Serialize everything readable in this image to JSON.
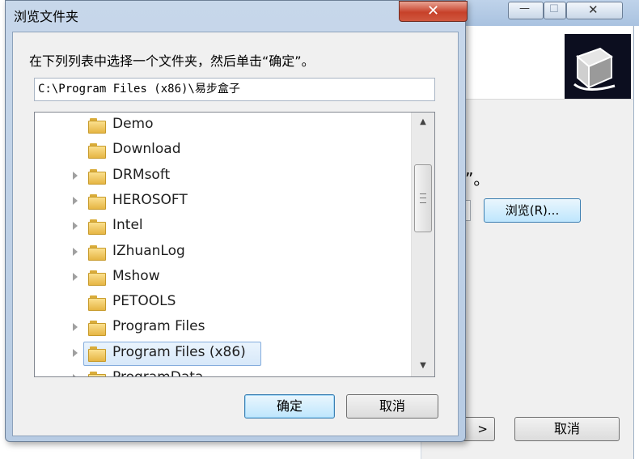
{
  "background_window": {
    "header_icon": "installer-box-icon",
    "text_fragment": "”。",
    "browse_label": "浏览(R)...",
    "back_label": ">",
    "cancel_label": "取消",
    "min_glyph": "—",
    "max_glyph": "☐",
    "close_glyph": "✕"
  },
  "dialog": {
    "title": "浏览文件夹",
    "close_glyph": "✕",
    "instruction": "在下列列表中选择一个文件夹，然后单击“确定”。",
    "path_value": "C:\\Program Files (x86)\\易步盒子",
    "folders": [
      {
        "name": "Demo",
        "expandable": false,
        "selected": false
      },
      {
        "name": "Download",
        "expandable": false,
        "selected": false
      },
      {
        "name": "DRMsoft",
        "expandable": true,
        "selected": false
      },
      {
        "name": "HEROSOFT",
        "expandable": true,
        "selected": false
      },
      {
        "name": "Intel",
        "expandable": true,
        "selected": false
      },
      {
        "name": "IZhuanLog",
        "expandable": true,
        "selected": false
      },
      {
        "name": "Mshow",
        "expandable": true,
        "selected": false
      },
      {
        "name": "PETOOLS",
        "expandable": false,
        "selected": false
      },
      {
        "name": "Program Files",
        "expandable": true,
        "selected": false
      },
      {
        "name": "Program Files (x86)",
        "expandable": true,
        "selected": true
      },
      {
        "name": "ProgramData",
        "expandable": true,
        "selected": false
      }
    ],
    "scroll_up_glyph": "▲",
    "scroll_down_glyph": "▼",
    "ok_label": "确定",
    "cancel_label": "取消"
  },
  "colors": {
    "titlebar": "#b7cbe3",
    "close_red": "#c7412a",
    "selection": "#d7e8f9",
    "folder_yellow": "#f2c85a"
  }
}
